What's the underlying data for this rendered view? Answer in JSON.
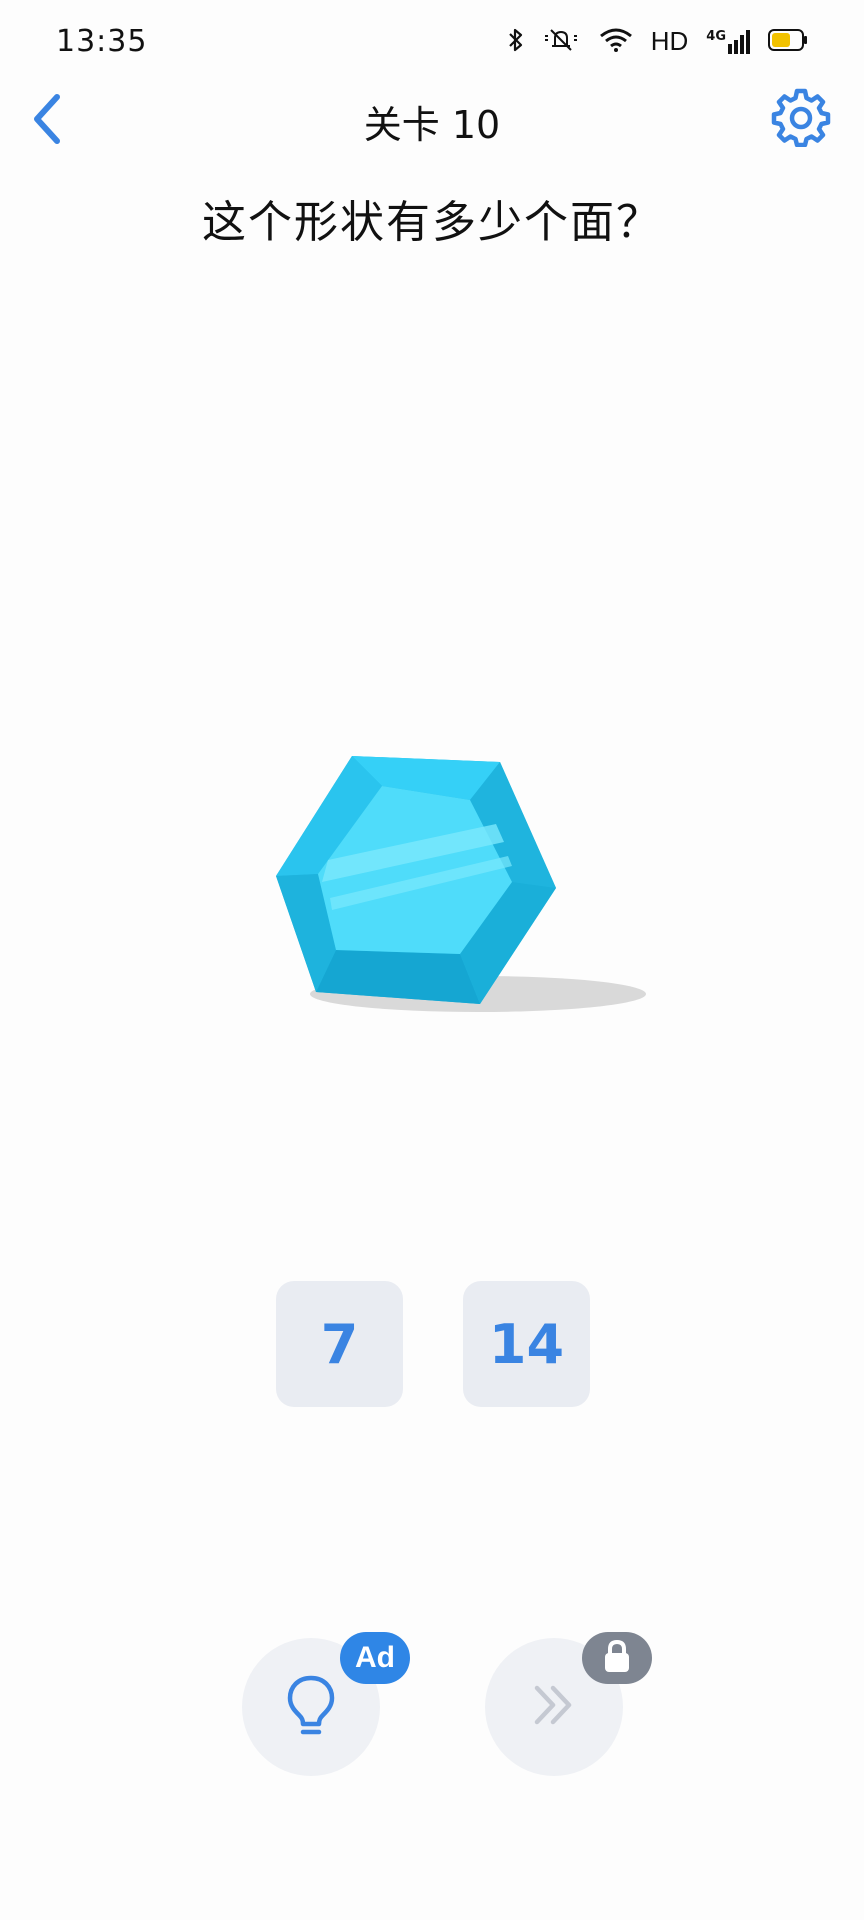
{
  "status_bar": {
    "time": "13:35",
    "hd_label": "HD",
    "network_label": "4G",
    "battery_color": "#F2C200"
  },
  "header": {
    "title": "关卡 10",
    "back_icon": "chevron-left-icon",
    "settings_icon": "gear-icon"
  },
  "question": {
    "text": "这个形状有多少个面？"
  },
  "shape": {
    "name": "hexagonal-gem",
    "colors": {
      "face": "#4FDCFA",
      "rim_top": "#35D0F7",
      "rim_side": "#22B9E2",
      "rim_bottom": "#15A6D2",
      "shadow": "#D9D9D9"
    }
  },
  "answers": [
    {
      "label": "7"
    },
    {
      "label": "14"
    }
  ],
  "actions": {
    "hint": {
      "icon": "lightbulb-icon",
      "badge": "Ad"
    },
    "skip": {
      "icon": "double-chevron-right-icon",
      "badge_icon": "lock-icon"
    }
  },
  "accent": "#3A84E2"
}
